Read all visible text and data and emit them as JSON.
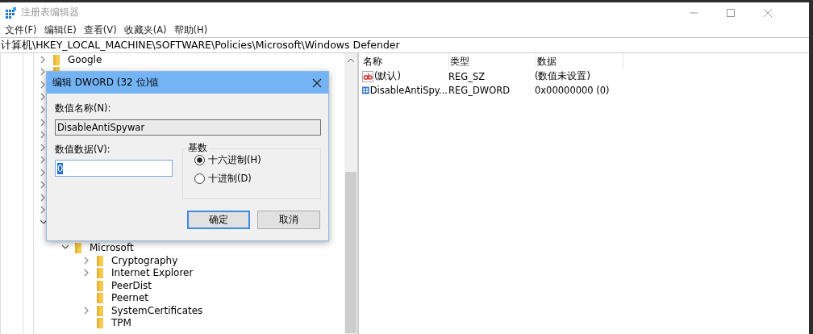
{
  "window": {
    "title": "注册表编辑器"
  },
  "menu": [
    "文件(F)",
    "编辑(E)",
    "查看(V)",
    "收藏夹(A)",
    "帮助(H)"
  ],
  "address": "计算机\\HKEY_LOCAL_MACHINE\\SOFTWARE\\Policies\\Microsoft\\Windows Defender",
  "tree": {
    "items": [
      {
        "label": "Google",
        "expanded": false,
        "has_children": true
      }
    ],
    "hidden_rows": [
      {
        "expanded": false
      },
      {
        "expanded": false
      },
      {
        "expanded": false
      },
      {
        "expanded": false
      },
      {
        "expanded": false
      },
      {
        "expanded": false
      },
      {
        "expanded": false
      },
      {
        "expanded": false
      },
      {
        "expanded": false
      },
      {
        "expanded": false
      },
      {
        "expanded": false
      },
      {
        "expanded": false
      },
      {
        "expanded": true
      }
    ],
    "lower": [
      {
        "label": "Microsoft",
        "expanded": true,
        "has_children": true,
        "children": [
          {
            "label": "Cryptography",
            "expanded": false,
            "has_children": true
          },
          {
            "label": "Internet Explorer",
            "expanded": false,
            "has_children": true
          },
          {
            "label": "PeerDist",
            "has_children": false
          },
          {
            "label": "Peernet",
            "has_children": false
          },
          {
            "label": "SystemCertificates",
            "expanded": false,
            "has_children": true
          },
          {
            "label": "TPM",
            "has_children": false
          }
        ]
      }
    ]
  },
  "list": {
    "columns": [
      "名称",
      "类型",
      "数据"
    ],
    "rows": [
      {
        "kind": "string",
        "name": "(默认)",
        "type": "REG_SZ",
        "data": "(数值未设置)"
      },
      {
        "kind": "binary",
        "name": "DisableAntiSpy...",
        "type": "REG_DWORD",
        "data": "0x00000000 (0)"
      }
    ]
  },
  "dialog": {
    "title": "编辑 DWORD (32 位)值",
    "name_label": "数值名称(N):",
    "name_value": "DisableAntiSpywar",
    "data_label": "数值数据(V):",
    "data_value": "0",
    "base_title": "基数",
    "bases": [
      {
        "label": "十六进制(H)",
        "selected": true
      },
      {
        "label": "十进制(D)",
        "selected": false
      }
    ],
    "buttons": [
      {
        "label": "确定",
        "default": true
      },
      {
        "label": "取消",
        "default": false
      }
    ]
  }
}
